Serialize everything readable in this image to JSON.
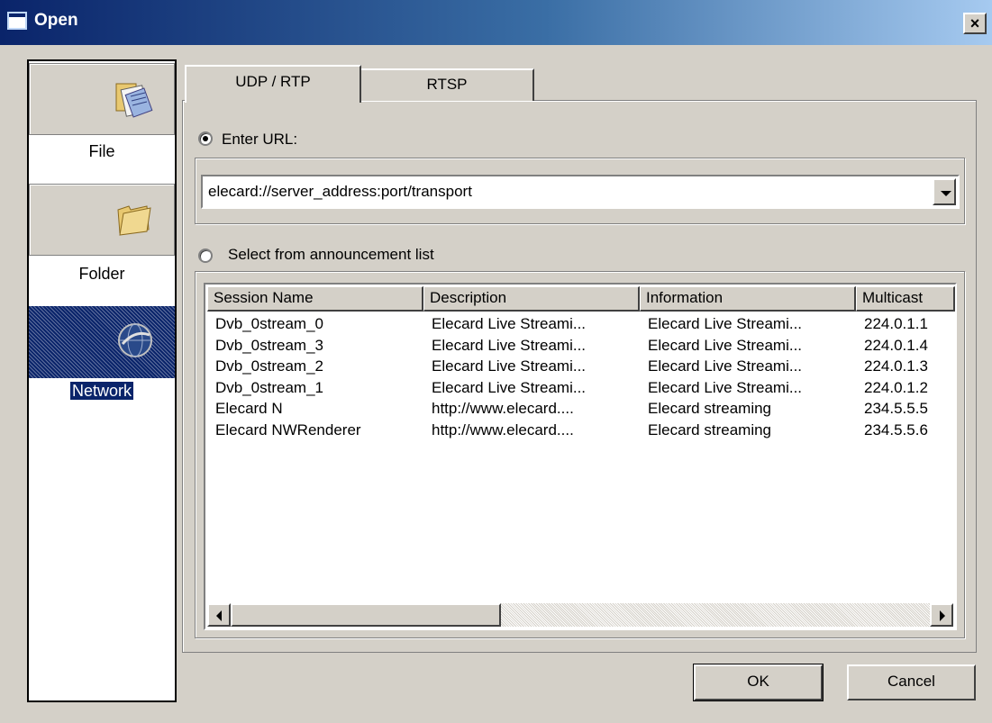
{
  "window": {
    "title": "Open",
    "close_glyph": "×"
  },
  "places": [
    {
      "label": "File",
      "icon": "file-icon",
      "selected": false
    },
    {
      "label": "Folder",
      "icon": "folder-icon",
      "selected": false
    },
    {
      "label": "Network",
      "icon": "network-globe-icon",
      "selected": true
    }
  ],
  "tabs": [
    {
      "label": "UDP / RTP",
      "active": true
    },
    {
      "label": "RTSP",
      "active": false
    }
  ],
  "enter_url": {
    "label": "Enter URL:",
    "selected": true,
    "value": "elecard://server_address:port/transport"
  },
  "announcement": {
    "label": "Select from announcement list",
    "selected": false
  },
  "list": {
    "columns": [
      "Session Name",
      "Description",
      "Information",
      "Multicast"
    ],
    "rows": [
      [
        "Dvb_0stream_0",
        "Elecard Live Streami...",
        "Elecard Live Streami...",
        "224.0.1.1"
      ],
      [
        "Dvb_0stream_3",
        "Elecard Live Streami...",
        "Elecard Live Streami...",
        "224.0.1.4"
      ],
      [
        "Dvb_0stream_2",
        "Elecard Live Streami...",
        "Elecard Live Streami...",
        "224.0.1.3"
      ],
      [
        "Dvb_0stream_1",
        "Elecard Live Streami...",
        "Elecard Live Streami...",
        "224.0.1.2"
      ],
      [
        "Elecard N",
        "http://www.elecard....",
        "Elecard streaming",
        "234.5.5.5"
      ],
      [
        "Elecard NWRenderer",
        "http://www.elecard....",
        "Elecard streaming",
        "234.5.5.6"
      ]
    ]
  },
  "buttons": {
    "ok": "OK",
    "cancel": "Cancel"
  },
  "colors": {
    "titlebar_start": "#0a246a",
    "titlebar_end": "#a6caf0",
    "face": "#d4d0c8",
    "selection": "#0a246a"
  }
}
